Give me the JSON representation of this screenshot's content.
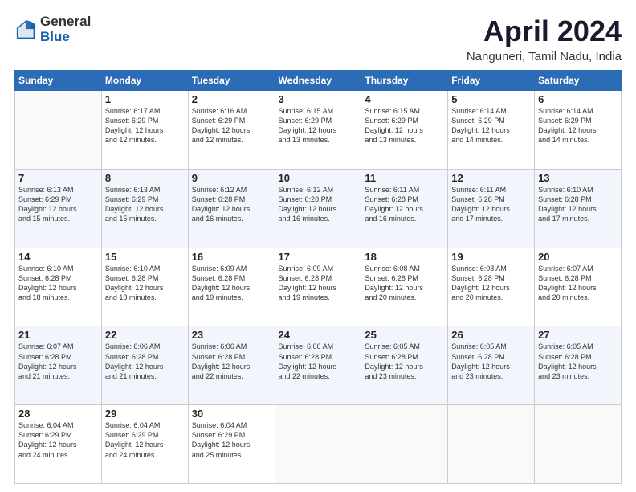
{
  "logo": {
    "general": "General",
    "blue": "Blue"
  },
  "title": "April 2024",
  "location": "Nanguneri, Tamil Nadu, India",
  "headers": [
    "Sunday",
    "Monday",
    "Tuesday",
    "Wednesday",
    "Thursday",
    "Friday",
    "Saturday"
  ],
  "weeks": [
    [
      {
        "day": "",
        "info": ""
      },
      {
        "day": "1",
        "info": "Sunrise: 6:17 AM\nSunset: 6:29 PM\nDaylight: 12 hours\nand 12 minutes."
      },
      {
        "day": "2",
        "info": "Sunrise: 6:16 AM\nSunset: 6:29 PM\nDaylight: 12 hours\nand 12 minutes."
      },
      {
        "day": "3",
        "info": "Sunrise: 6:15 AM\nSunset: 6:29 PM\nDaylight: 12 hours\nand 13 minutes."
      },
      {
        "day": "4",
        "info": "Sunrise: 6:15 AM\nSunset: 6:29 PM\nDaylight: 12 hours\nand 13 minutes."
      },
      {
        "day": "5",
        "info": "Sunrise: 6:14 AM\nSunset: 6:29 PM\nDaylight: 12 hours\nand 14 minutes."
      },
      {
        "day": "6",
        "info": "Sunrise: 6:14 AM\nSunset: 6:29 PM\nDaylight: 12 hours\nand 14 minutes."
      }
    ],
    [
      {
        "day": "7",
        "info": "Sunrise: 6:13 AM\nSunset: 6:29 PM\nDaylight: 12 hours\nand 15 minutes."
      },
      {
        "day": "8",
        "info": "Sunrise: 6:13 AM\nSunset: 6:29 PM\nDaylight: 12 hours\nand 15 minutes."
      },
      {
        "day": "9",
        "info": "Sunrise: 6:12 AM\nSunset: 6:28 PM\nDaylight: 12 hours\nand 16 minutes."
      },
      {
        "day": "10",
        "info": "Sunrise: 6:12 AM\nSunset: 6:28 PM\nDaylight: 12 hours\nand 16 minutes."
      },
      {
        "day": "11",
        "info": "Sunrise: 6:11 AM\nSunset: 6:28 PM\nDaylight: 12 hours\nand 16 minutes."
      },
      {
        "day": "12",
        "info": "Sunrise: 6:11 AM\nSunset: 6:28 PM\nDaylight: 12 hours\nand 17 minutes."
      },
      {
        "day": "13",
        "info": "Sunrise: 6:10 AM\nSunset: 6:28 PM\nDaylight: 12 hours\nand 17 minutes."
      }
    ],
    [
      {
        "day": "14",
        "info": "Sunrise: 6:10 AM\nSunset: 6:28 PM\nDaylight: 12 hours\nand 18 minutes."
      },
      {
        "day": "15",
        "info": "Sunrise: 6:10 AM\nSunset: 6:28 PM\nDaylight: 12 hours\nand 18 minutes."
      },
      {
        "day": "16",
        "info": "Sunrise: 6:09 AM\nSunset: 6:28 PM\nDaylight: 12 hours\nand 19 minutes."
      },
      {
        "day": "17",
        "info": "Sunrise: 6:09 AM\nSunset: 6:28 PM\nDaylight: 12 hours\nand 19 minutes."
      },
      {
        "day": "18",
        "info": "Sunrise: 6:08 AM\nSunset: 6:28 PM\nDaylight: 12 hours\nand 20 minutes."
      },
      {
        "day": "19",
        "info": "Sunrise: 6:08 AM\nSunset: 6:28 PM\nDaylight: 12 hours\nand 20 minutes."
      },
      {
        "day": "20",
        "info": "Sunrise: 6:07 AM\nSunset: 6:28 PM\nDaylight: 12 hours\nand 20 minutes."
      }
    ],
    [
      {
        "day": "21",
        "info": "Sunrise: 6:07 AM\nSunset: 6:28 PM\nDaylight: 12 hours\nand 21 minutes."
      },
      {
        "day": "22",
        "info": "Sunrise: 6:06 AM\nSunset: 6:28 PM\nDaylight: 12 hours\nand 21 minutes."
      },
      {
        "day": "23",
        "info": "Sunrise: 6:06 AM\nSunset: 6:28 PM\nDaylight: 12 hours\nand 22 minutes."
      },
      {
        "day": "24",
        "info": "Sunrise: 6:06 AM\nSunset: 6:28 PM\nDaylight: 12 hours\nand 22 minutes."
      },
      {
        "day": "25",
        "info": "Sunrise: 6:05 AM\nSunset: 6:28 PM\nDaylight: 12 hours\nand 23 minutes."
      },
      {
        "day": "26",
        "info": "Sunrise: 6:05 AM\nSunset: 6:28 PM\nDaylight: 12 hours\nand 23 minutes."
      },
      {
        "day": "27",
        "info": "Sunrise: 6:05 AM\nSunset: 6:28 PM\nDaylight: 12 hours\nand 23 minutes."
      }
    ],
    [
      {
        "day": "28",
        "info": "Sunrise: 6:04 AM\nSunset: 6:29 PM\nDaylight: 12 hours\nand 24 minutes."
      },
      {
        "day": "29",
        "info": "Sunrise: 6:04 AM\nSunset: 6:29 PM\nDaylight: 12 hours\nand 24 minutes."
      },
      {
        "day": "30",
        "info": "Sunrise: 6:04 AM\nSunset: 6:29 PM\nDaylight: 12 hours\nand 25 minutes."
      },
      {
        "day": "",
        "info": ""
      },
      {
        "day": "",
        "info": ""
      },
      {
        "day": "",
        "info": ""
      },
      {
        "day": "",
        "info": ""
      }
    ]
  ]
}
